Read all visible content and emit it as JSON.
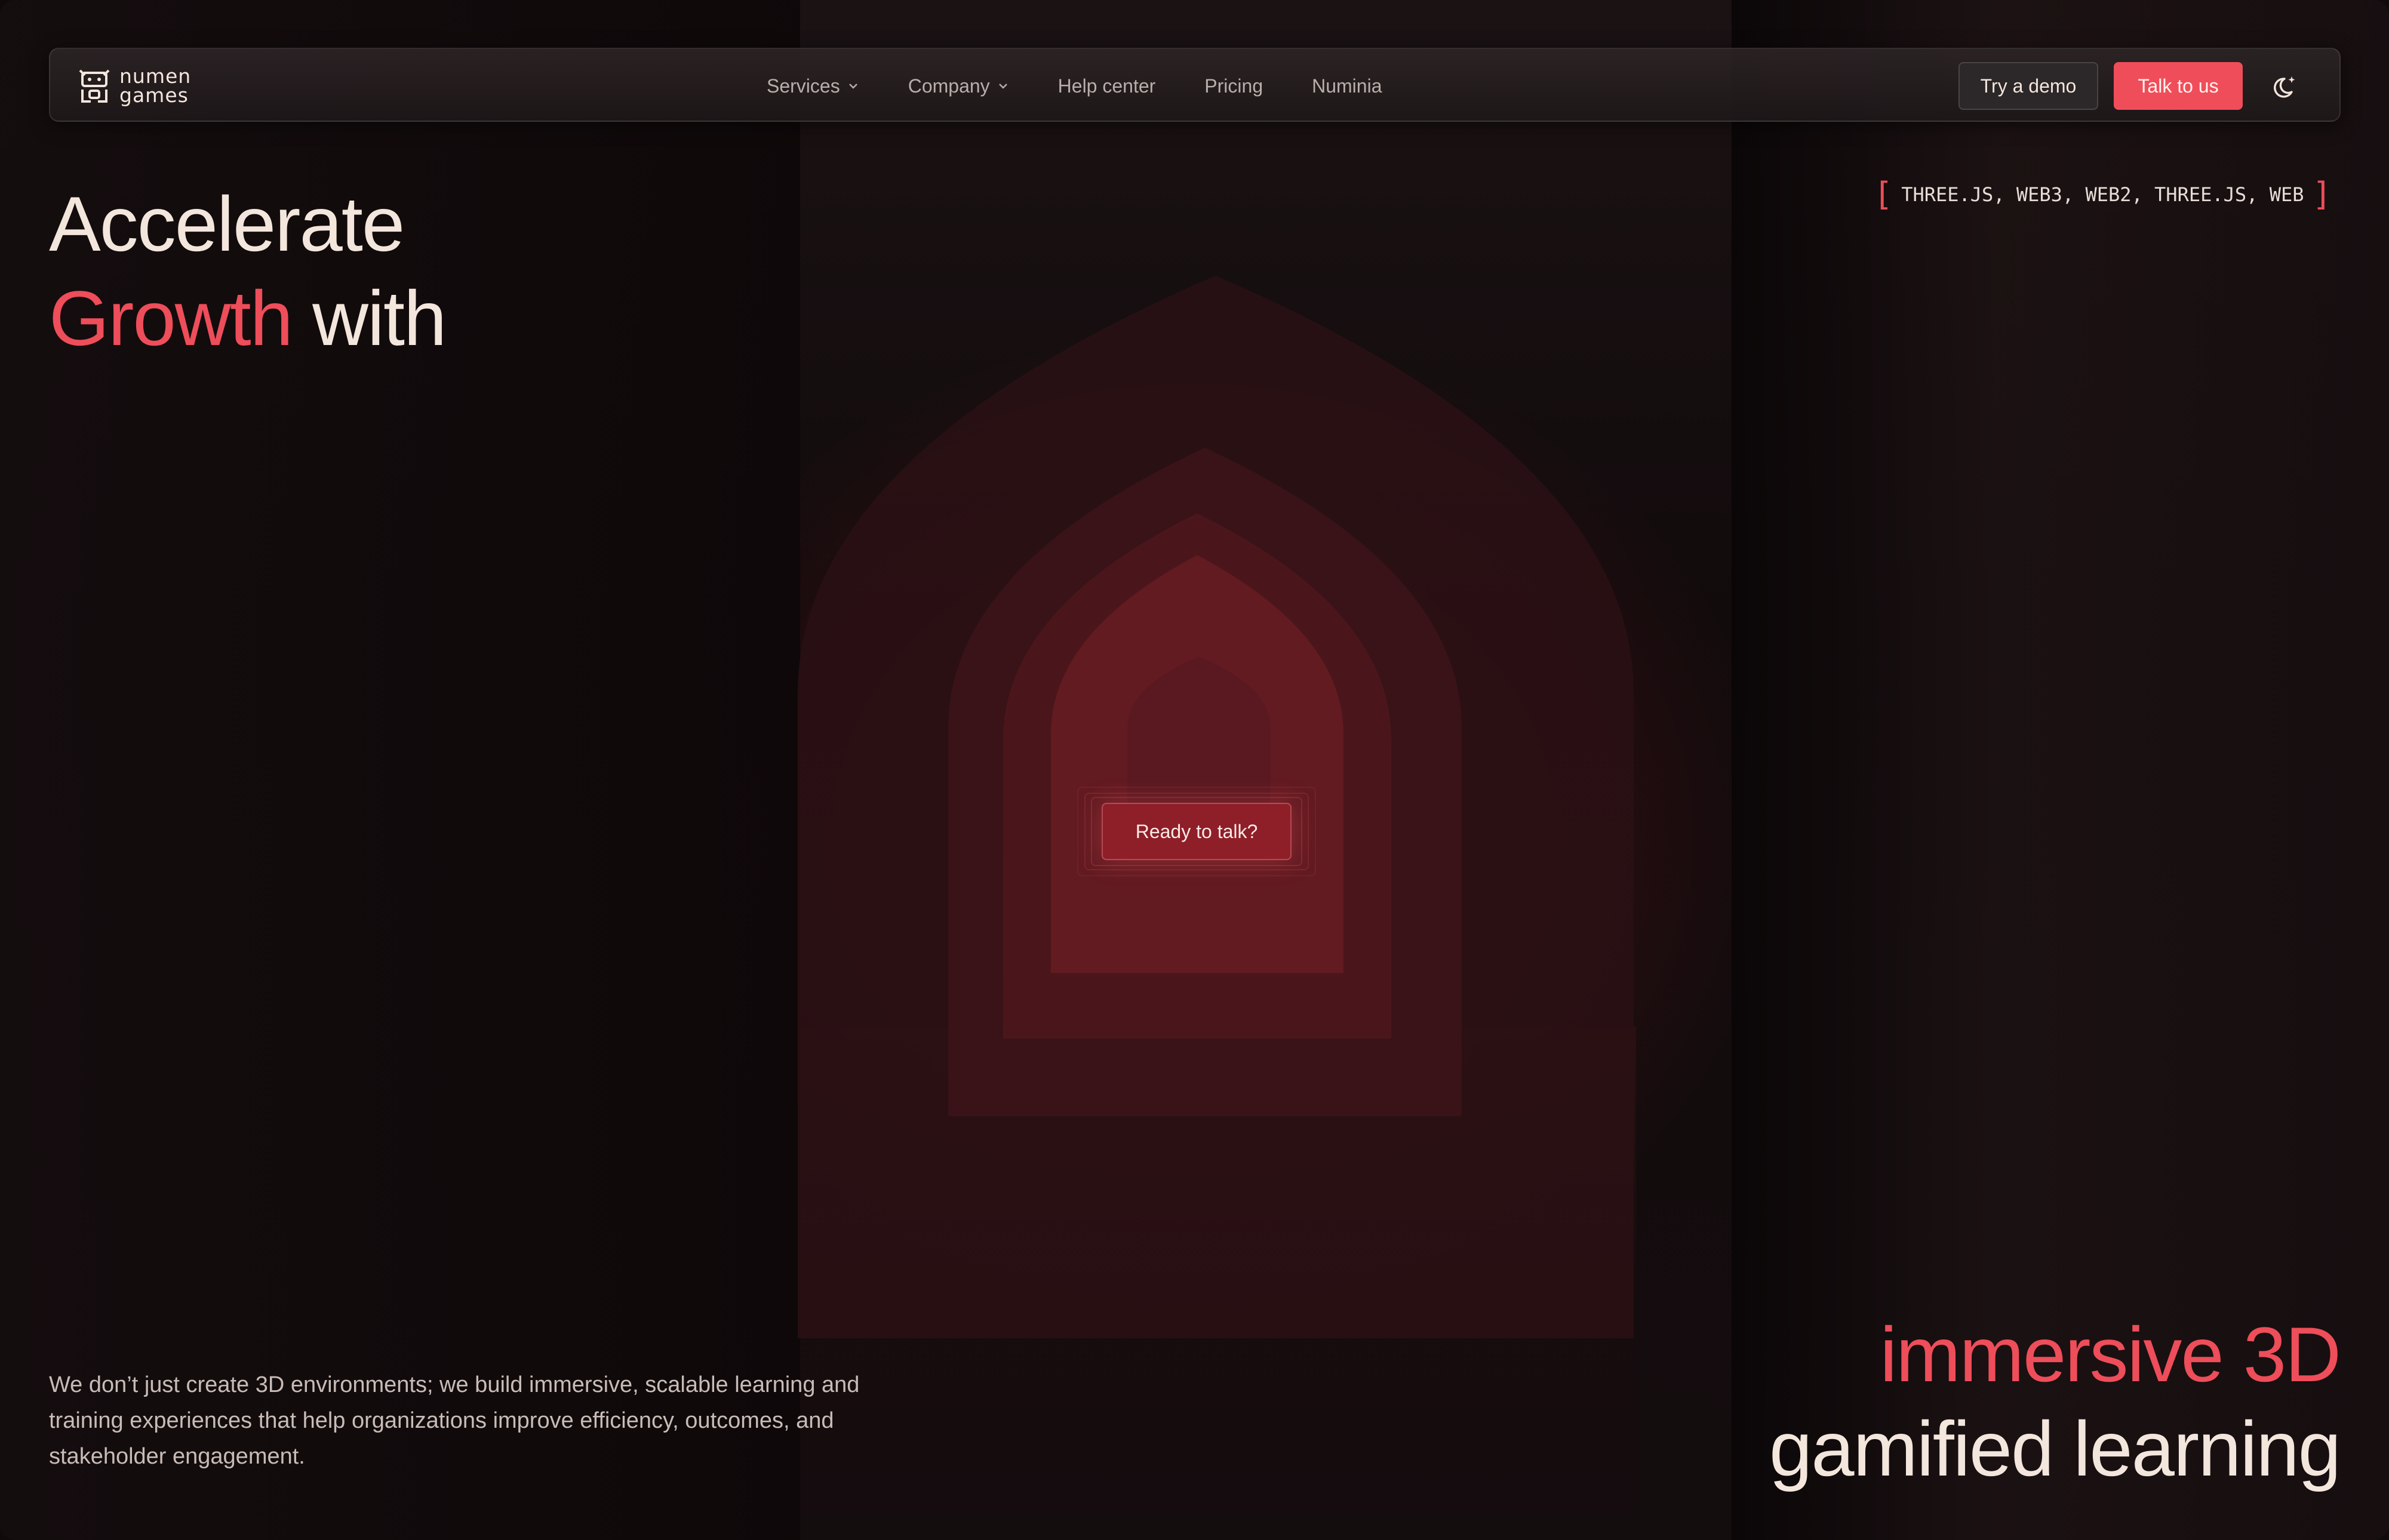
{
  "brand": {
    "name_line1": "numen",
    "name_line2": "games"
  },
  "nav": {
    "items": [
      {
        "label": "Services",
        "has_dropdown": true
      },
      {
        "label": "Company",
        "has_dropdown": true
      },
      {
        "label": "Help center",
        "has_dropdown": false
      },
      {
        "label": "Pricing",
        "has_dropdown": false
      },
      {
        "label": "Numinia",
        "has_dropdown": false
      }
    ],
    "try_demo_label": "Try a demo",
    "talk_label": "Talk to us",
    "theme_icon": "moon-icon"
  },
  "hero": {
    "headline_line1": "Accelerate",
    "headline_accent": "Growth",
    "headline_rest": " with",
    "tech_tags": "THREE.JS, WEB3, WEB2, THREE.JS, WEB",
    "cta_label": "Ready to talk?",
    "description": "We don’t just create 3D environments; we build immersive, scalable learning and training experiences that help organizations improve efficiency, outcomes, and stakeholder engagement.",
    "tagline_line1": "immersive 3D",
    "tagline_line2": "gamified learning"
  },
  "colors": {
    "accent": "#ee4d5a",
    "background": "#100a0b",
    "text": "#f3e6dc"
  }
}
